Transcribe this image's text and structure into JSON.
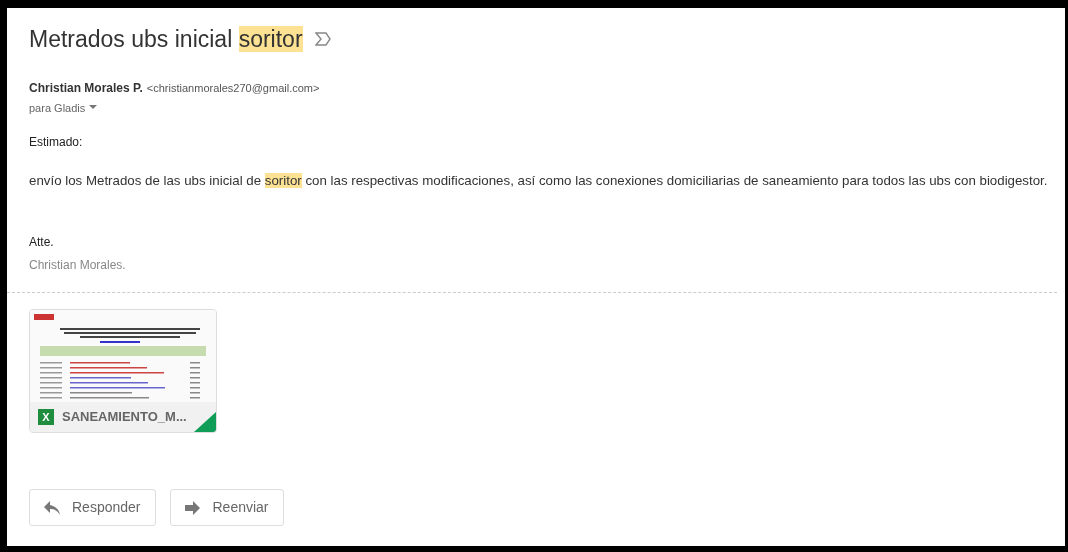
{
  "subject": {
    "parts": [
      {
        "text": "Metrados ubs inicial ",
        "highlighted": false
      },
      {
        "text": "soritor",
        "highlighted": true
      }
    ]
  },
  "sender": {
    "name": "Christian Morales P.",
    "email": "<christianmorales270@gmail.com>",
    "recipients": "para Gladis"
  },
  "body": {
    "greeting": "Estimado:",
    "paragraph": [
      {
        "text": "envío los Metrados de las ubs inicial de ",
        "highlighted": false
      },
      {
        "text": "soritor",
        "highlighted": true
      },
      {
        "text": " con las respectivas modificaciones, así como las conexiones domiciliarias de saneamiento para todos las ubs con biodigestor.",
        "highlighted": false
      }
    ],
    "closing": "Atte.",
    "signature": "Christian Morales."
  },
  "attachments": [
    {
      "name": "SANEAMIENTO_M...",
      "file_icon": "X"
    }
  ],
  "actions": [
    {
      "label": "Responder",
      "kind": "reply"
    },
    {
      "label": "Reenviar",
      "kind": "forward"
    }
  ]
}
